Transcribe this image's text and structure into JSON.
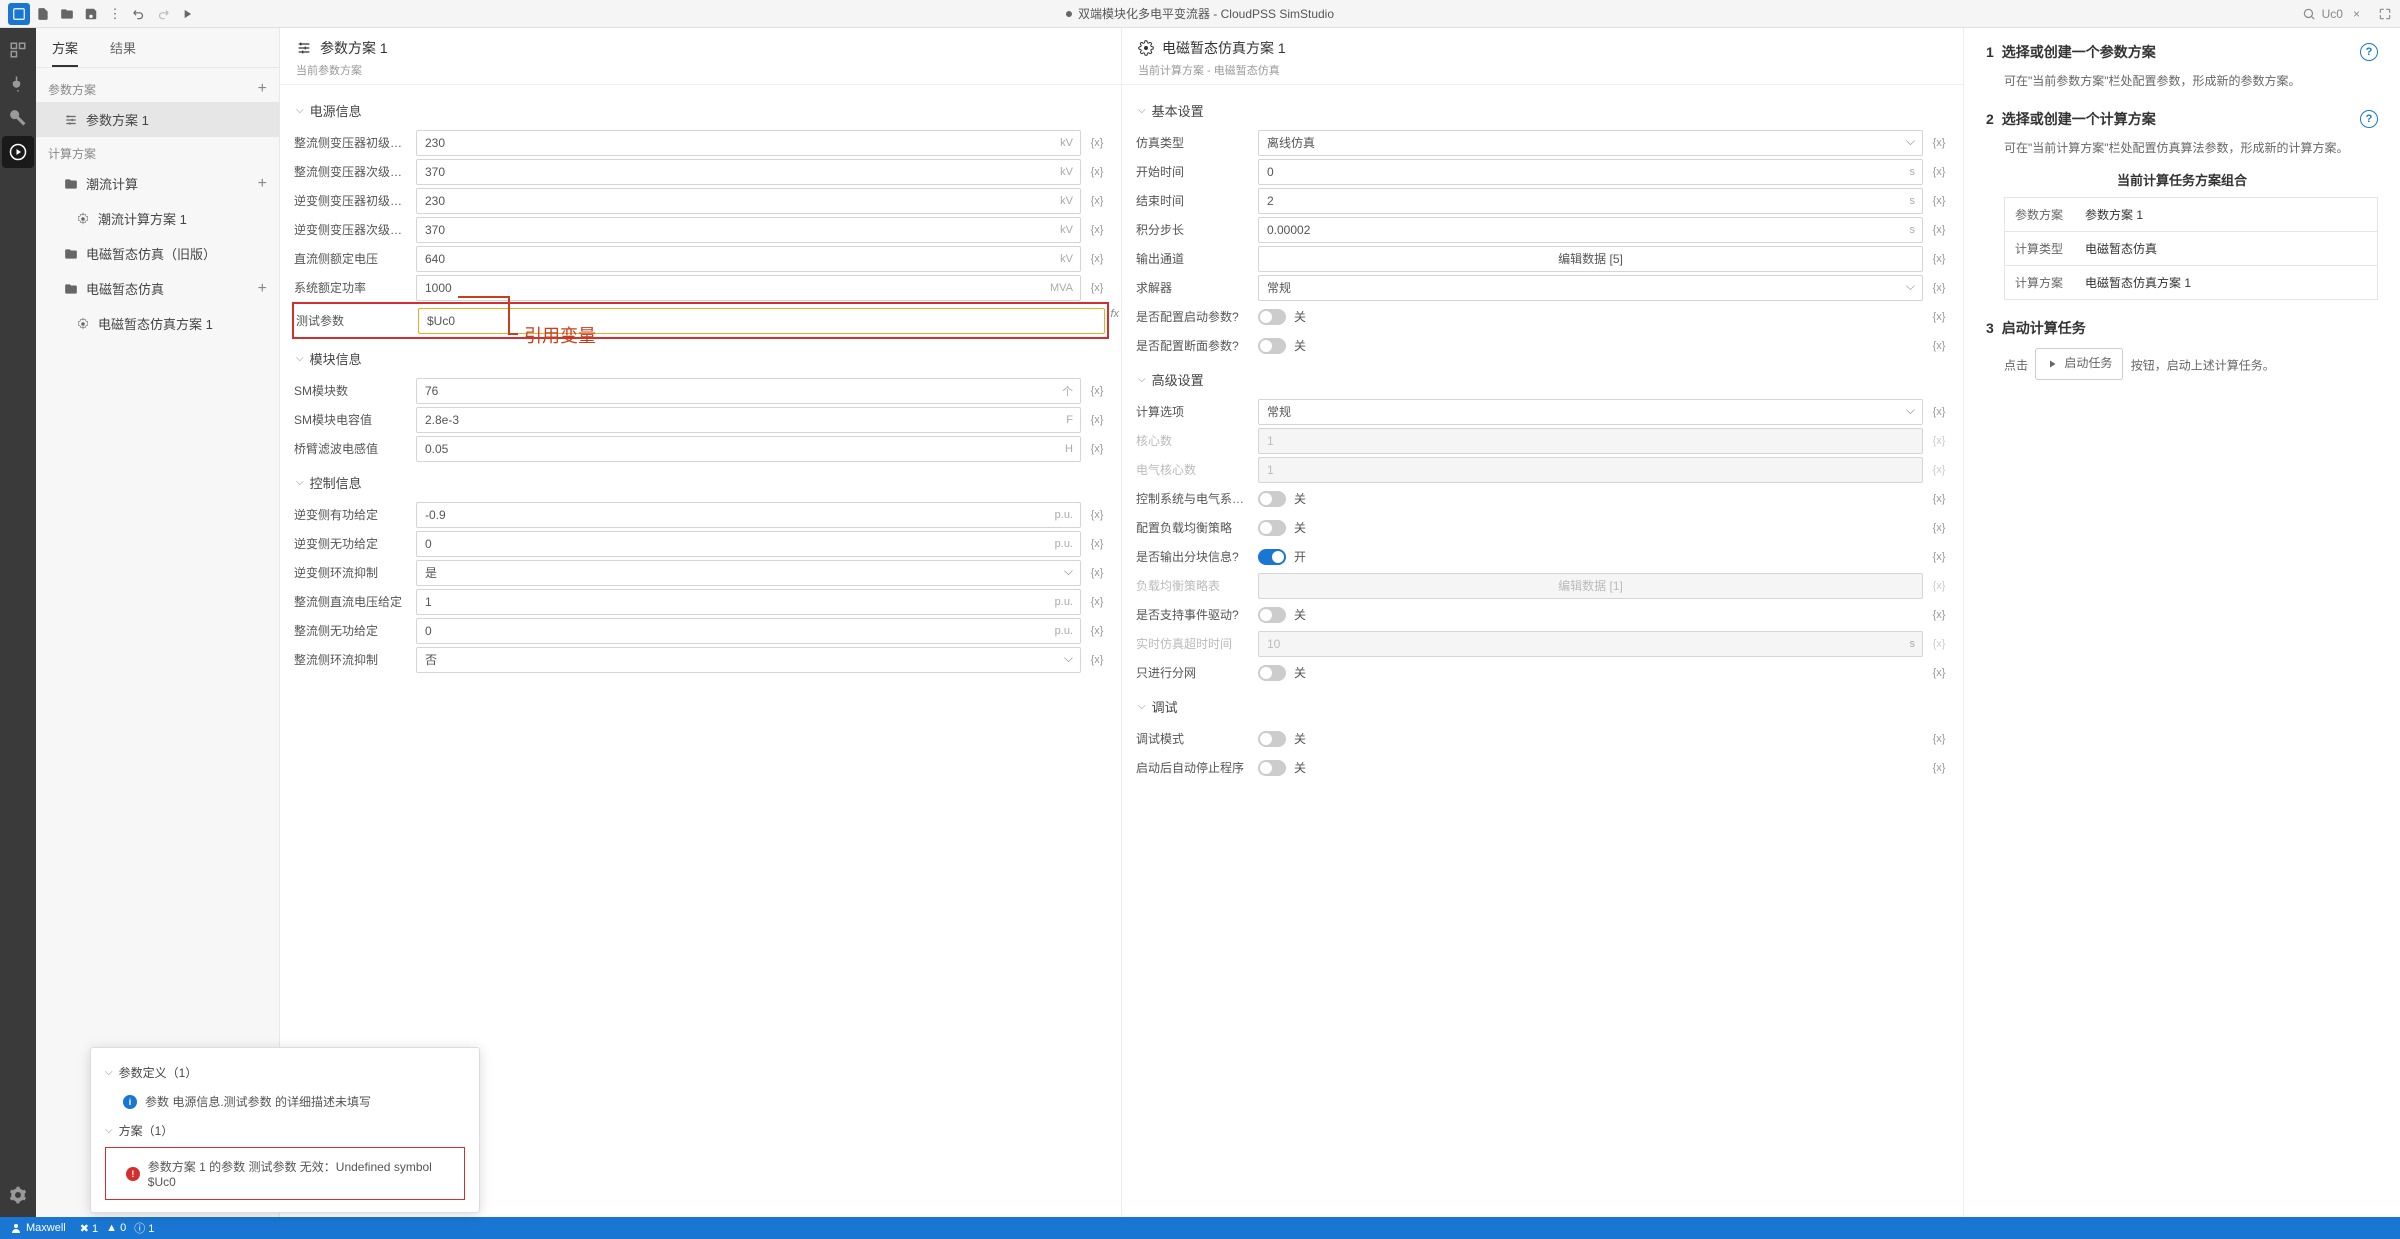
{
  "toolbar": {
    "title": "双端模块化多电平变流器 - CloudPSS SimStudio",
    "search_value": "Uc0"
  },
  "left": {
    "tabs": {
      "plan": "方案",
      "result": "结果"
    },
    "sec_param": "参数方案",
    "param_item": "参数方案 1",
    "sec_calc": "计算方案",
    "flow": "潮流计算",
    "flow_item": "潮流计算方案 1",
    "emt_old": "电磁暂态仿真（旧版）",
    "emt": "电磁暂态仿真",
    "emt_item": "电磁暂态仿真方案 1"
  },
  "col1": {
    "title": "参数方案 1",
    "sub": "当前参数方案",
    "g_power": "电源信息",
    "p1": {
      "label": "整流侧变压器初级额...",
      "value": "230",
      "unit": "kV"
    },
    "p2": {
      "label": "整流侧变压器次级额...",
      "value": "370",
      "unit": "kV"
    },
    "p3": {
      "label": "逆变侧变压器初级额...",
      "value": "230",
      "unit": "kV"
    },
    "p4": {
      "label": "逆变侧变压器次级额...",
      "value": "370",
      "unit": "kV"
    },
    "p5": {
      "label": "直流侧额定电压",
      "value": "640",
      "unit": "kV"
    },
    "p6": {
      "label": "系统额定功率",
      "value": "1000",
      "unit": "MVA"
    },
    "p7": {
      "label": "测试参数",
      "value": "$Uc0"
    },
    "g_mod": "模块信息",
    "m1": {
      "label": "SM模块数",
      "value": "76",
      "unit": "个"
    },
    "m2": {
      "label": "SM模块电容值",
      "value": "2.8e-3",
      "unit": "F"
    },
    "m3": {
      "label": "桥臂滤波电感值",
      "value": "0.05",
      "unit": "H"
    },
    "g_ctrl": "控制信息",
    "c1": {
      "label": "逆变侧有功给定",
      "value": "-0.9",
      "unit": "p.u."
    },
    "c2": {
      "label": "逆变侧无功给定",
      "value": "0",
      "unit": "p.u."
    },
    "c3": {
      "label": "逆变侧环流抑制",
      "value": "是"
    },
    "c4": {
      "label": "整流侧直流电压给定",
      "value": "1",
      "unit": "p.u."
    },
    "c5": {
      "label": "整流侧无功给定",
      "value": "0",
      "unit": "p.u."
    },
    "c6": {
      "label": "整流侧环流抑制",
      "value": "否"
    },
    "annotation": "引用变量"
  },
  "col2": {
    "title": "电磁暂态仿真方案 1",
    "sub": "当前计算方案 - 电磁暂态仿真",
    "g_basic": "基本设置",
    "b1": {
      "label": "仿真类型",
      "value": "离线仿真"
    },
    "b2": {
      "label": "开始时间",
      "value": "0",
      "unit": "s"
    },
    "b3": {
      "label": "结束时间",
      "value": "2",
      "unit": "s"
    },
    "b4": {
      "label": "积分步长",
      "value": "0.00002",
      "unit": "s"
    },
    "b5": {
      "label": "输出通道",
      "value": "编辑数据 [5]"
    },
    "b6": {
      "label": "求解器",
      "value": "常规"
    },
    "b7": {
      "label": "是否配置启动参数?",
      "value": "关"
    },
    "b8": {
      "label": "是否配置断面参数?",
      "value": "关"
    },
    "g_adv": "高级设置",
    "a1": {
      "label": "计算选项",
      "value": "常规"
    },
    "a2": {
      "label": "核心数",
      "value": "1"
    },
    "a3": {
      "label": "电气核心数",
      "value": "1"
    },
    "a4": {
      "label": "控制系统与电气系统...",
      "value": "关"
    },
    "a5": {
      "label": "配置负载均衡策略",
      "value": "关"
    },
    "a6": {
      "label": "是否输出分块信息?",
      "value": "开"
    },
    "a7": {
      "label": "负载均衡策略表",
      "value": "编辑数据 [1]"
    },
    "a8": {
      "label": "是否支持事件驱动?",
      "value": "关"
    },
    "a9": {
      "label": "实时仿真超时时间",
      "value": "10",
      "unit": "s"
    },
    "a10": {
      "label": "只进行分网",
      "value": "关"
    },
    "g_debug": "调试",
    "d1": {
      "label": "调试模式",
      "value": "关"
    },
    "d2": {
      "label": "启动后自动停止程序",
      "value": "关"
    }
  },
  "right": {
    "s1_title": "选择或创建一个参数方案",
    "s1_desc": "可在\"当前参数方案\"栏处配置参数，形成新的参数方案。",
    "s2_title": "选择或创建一个计算方案",
    "s2_desc": "可在\"当前计算方案\"栏处配置仿真算法参数，形成新的计算方案。",
    "combo_title": "当前计算任务方案组合",
    "t1": {
      "k": "参数方案",
      "v": "参数方案 1"
    },
    "t2": {
      "k": "计算类型",
      "v": "电磁暂态仿真"
    },
    "t3": {
      "k": "计算方案",
      "v": "电磁暂态仿真方案 1"
    },
    "s3_title": "启动计算任务",
    "s3_pre": "点击",
    "s3_btn": "启动任务",
    "s3_post": "按钮，启动上述计算任务。"
  },
  "popup": {
    "sec1": "参数定义（1）",
    "item1": "参数 电源信息.测试参数 的详细描述未填写",
    "sec2": "方案（1）",
    "item2": "参数方案 1 的参数 测试参数 无效：Undefined symbol $Uc0"
  },
  "status": {
    "user": "Maxwell",
    "err": "1",
    "warn": "0",
    "info": "1"
  },
  "x_label": "{x}"
}
